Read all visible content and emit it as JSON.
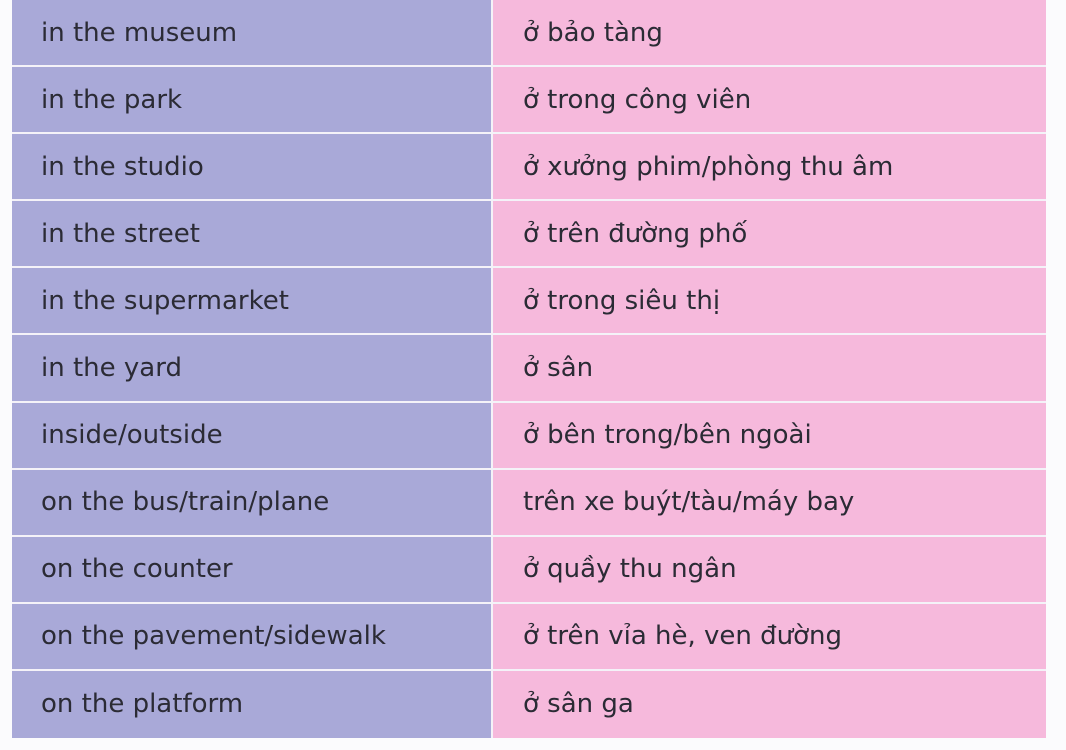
{
  "rows": [
    {
      "en": "in the museum",
      "vi": "ở bảo tàng"
    },
    {
      "en": "in the park",
      "vi": "ở trong công viên"
    },
    {
      "en": "in the studio",
      "vi": "ở xưởng phim/phòng thu âm"
    },
    {
      "en": "in the street",
      "vi": "ở trên đường phố"
    },
    {
      "en": "in the supermarket",
      "vi": "ở trong siêu thị"
    },
    {
      "en": "in the yard",
      "vi": "ở sân"
    },
    {
      "en": "inside/outside",
      "vi": "ở bên trong/bên ngoài"
    },
    {
      "en": "on the bus/train/plane",
      "vi": "trên xe buýt/tàu/máy bay"
    },
    {
      "en": "on the counter",
      "vi": "ở quầy thu ngân"
    },
    {
      "en": "on the pavement/sidewalk",
      "vi": "ở trên vỉa hè, ven đường"
    },
    {
      "en": "on the platform",
      "vi": "ở sân ga"
    }
  ],
  "colors": {
    "english_column": "#a9a9d8",
    "vietnamese_column": "#f6b9dc",
    "text": "#2b2b35"
  }
}
